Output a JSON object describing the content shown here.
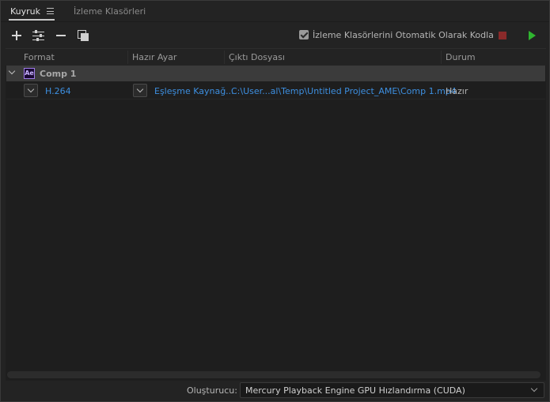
{
  "tabs": {
    "queue": "Kuyruk",
    "watch_folders": "İzleme Klasörleri"
  },
  "toolbar": {
    "icons": [
      "plus-icon",
      "sliders-icon",
      "minus-icon",
      "duplicate-icon",
      "stop-icon",
      "play-icon"
    ],
    "auto_encode_label": "İzleme Klasörlerini Otomatik Olarak Kodla",
    "auto_encode_checked": true,
    "colors": {
      "stop": "#8a2a2a",
      "play": "#2fb52f"
    }
  },
  "table": {
    "columns": {
      "format": "Format",
      "preset": "Hazır Ayar",
      "output": "Çıktı Dosyası",
      "status": "Durum"
    },
    "groups": [
      {
        "badge": "Ae",
        "name": "Comp 1",
        "outputs": [
          {
            "format": "H.264",
            "preset": "Eşleşme Kaynağ...",
            "output_file": "C:\\User...al\\Temp\\Untitled Project_AME\\Comp 1.mp4",
            "status": "Hazır"
          }
        ]
      }
    ],
    "link_color": "#3d8fe0"
  },
  "footer": {
    "renderer_label": "Oluşturucu:",
    "renderer_value": "Mercury Playback Engine GPU Hızlandırma (CUDA)"
  }
}
